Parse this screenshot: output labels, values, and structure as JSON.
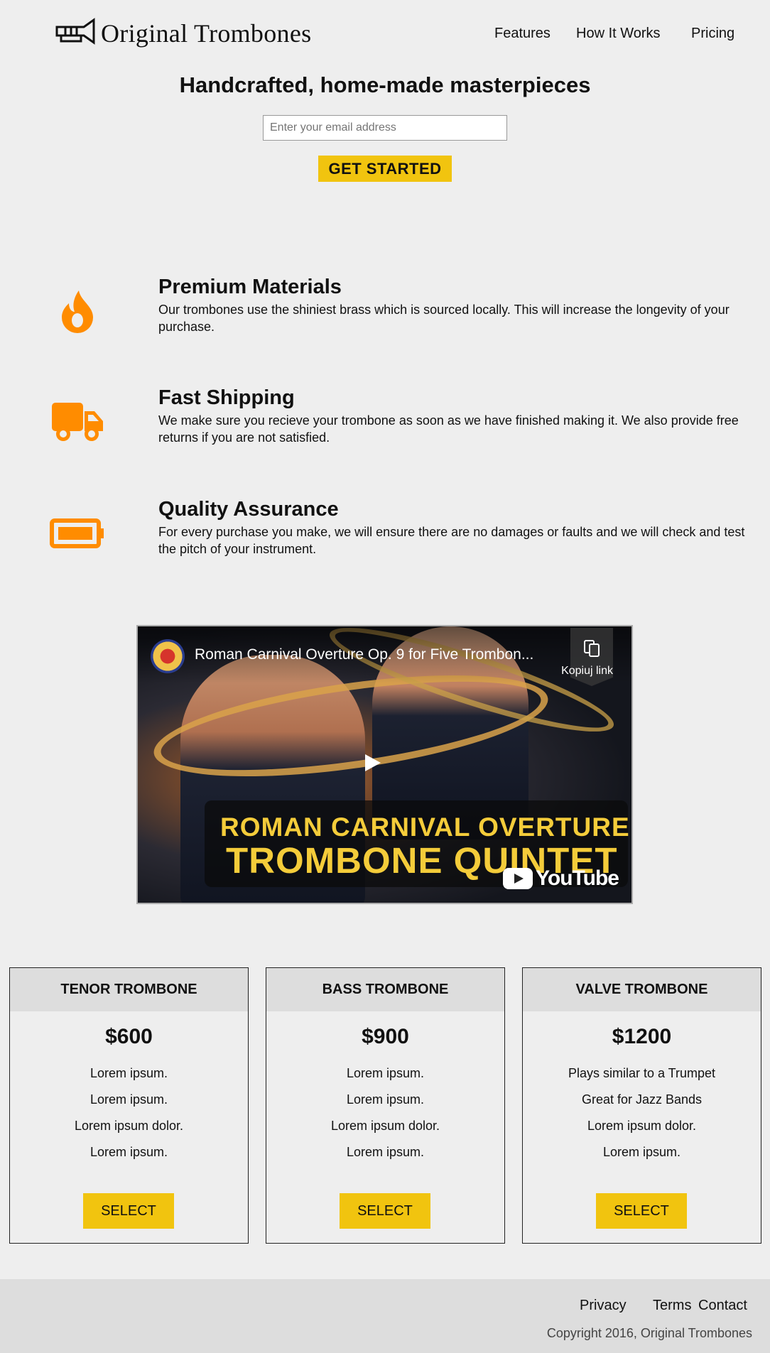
{
  "header": {
    "brand": "Original Trombones",
    "logo_icon": "trumpet-logo-icon",
    "nav": [
      {
        "label": "Features"
      },
      {
        "label": "How It Works"
      },
      {
        "label": "Pricing"
      }
    ]
  },
  "hero": {
    "title": "Handcrafted, home-made masterpieces",
    "email_placeholder": "Enter your email address",
    "email_value": "",
    "cta_label": "GET STARTED"
  },
  "features": [
    {
      "icon": "fire-icon",
      "title": "Premium Materials",
      "text": "Our trombones use the shiniest brass which is sourced locally. This will increase the longevity of your purchase."
    },
    {
      "icon": "truck-icon",
      "title": "Fast Shipping",
      "text": "We make sure you recieve your trombone as soon as we have finished making it. We also provide free returns if you are not satisfied."
    },
    {
      "icon": "battery-icon",
      "title": "Quality Assurance",
      "text": "For every purchase you make, we will ensure there are no damages or faults and we will check and test the pitch of your instrument."
    }
  ],
  "video": {
    "title": "Roman Carnival Overture Op. 9 for Five Trombon...",
    "copy_link_label": "Kopiuj link",
    "banner_line1": "ROMAN CARNIVAL OVERTURE",
    "banner_line2": "TROMBONE QUINTET",
    "platform": "YouTube"
  },
  "pricing": [
    {
      "name": "TENOR TROMBONE",
      "price": "$600",
      "features": [
        "Lorem ipsum.",
        "Lorem ipsum.",
        "Lorem ipsum dolor.",
        "Lorem ipsum."
      ],
      "button": "SELECT"
    },
    {
      "name": "BASS TROMBONE",
      "price": "$900",
      "features": [
        "Lorem ipsum.",
        "Lorem ipsum.",
        "Lorem ipsum dolor.",
        "Lorem ipsum."
      ],
      "button": "SELECT"
    },
    {
      "name": "VALVE TROMBONE",
      "price": "$1200",
      "features": [
        "Plays similar to a Trumpet",
        "Great for Jazz Bands",
        "Lorem ipsum dolor.",
        "Lorem ipsum."
      ],
      "button": "SELECT"
    }
  ],
  "footer": {
    "links": [
      {
        "label": "Privacy"
      },
      {
        "label": "Terms"
      },
      {
        "label": "Contact"
      }
    ],
    "copyright": "Copyright 2016, Original Trombones"
  },
  "colors": {
    "accent_orange": "#ff8c00",
    "button_yellow": "#f1c40f",
    "background": "#eeeeee",
    "panel_gray": "#dddddd"
  }
}
